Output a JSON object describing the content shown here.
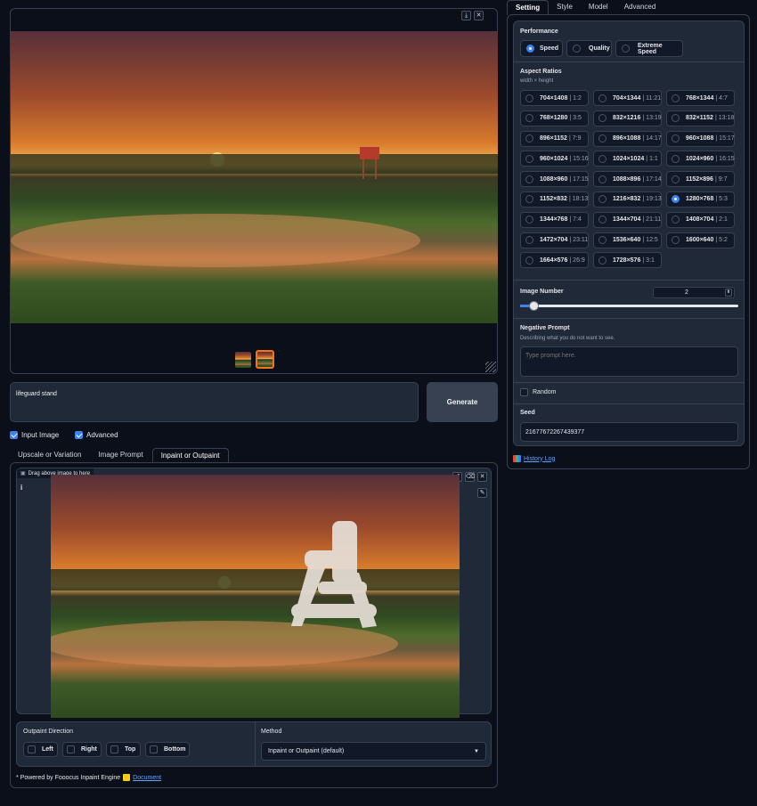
{
  "gallery": {
    "thumbnails": [
      "sunset-thumb-1",
      "sunset-thumb-2"
    ]
  },
  "prompt": {
    "value": "lifeguard stand"
  },
  "generate_label": "Generate",
  "checkboxes": {
    "input_image": {
      "label": "Input Image",
      "checked": true
    },
    "advanced": {
      "label": "Advanced",
      "checked": true
    }
  },
  "input_tabs": {
    "upscale": "Upscale or Variation",
    "image_prompt": "Image Prompt",
    "inpaint": "Inpaint or Outpaint"
  },
  "inpaint_canvas": {
    "drag_label": "Drag above image to here",
    "info_glyph": "i"
  },
  "outpaint": {
    "title": "Outpaint Direction",
    "options": [
      "Left",
      "Right",
      "Top",
      "Bottom"
    ]
  },
  "method": {
    "title": "Method",
    "value": "Inpaint or Outpaint (default)"
  },
  "footer": {
    "text": "* Powered by Fooocus Inpaint Engine",
    "link": "Document"
  },
  "settings_tabs": [
    "Setting",
    "Style",
    "Model",
    "Advanced"
  ],
  "performance": {
    "title": "Performance",
    "options": [
      "Speed",
      "Quality",
      "Extreme Speed"
    ],
    "selected": "Speed"
  },
  "aspect": {
    "title": "Aspect Ratios",
    "subtitle": "width × height",
    "options": [
      {
        "size": "704×1408",
        "ratio": "1:2"
      },
      {
        "size": "704×1344",
        "ratio": "11:21"
      },
      {
        "size": "768×1344",
        "ratio": "4:7"
      },
      {
        "size": "768×1280",
        "ratio": "3:5"
      },
      {
        "size": "832×1216",
        "ratio": "13:19"
      },
      {
        "size": "832×1152",
        "ratio": "13:18"
      },
      {
        "size": "896×1152",
        "ratio": "7:9"
      },
      {
        "size": "896×1088",
        "ratio": "14:17"
      },
      {
        "size": "960×1088",
        "ratio": "15:17"
      },
      {
        "size": "960×1024",
        "ratio": "15:16"
      },
      {
        "size": "1024×1024",
        "ratio": "1:1"
      },
      {
        "size": "1024×960",
        "ratio": "16:15"
      },
      {
        "size": "1088×960",
        "ratio": "17:15"
      },
      {
        "size": "1088×896",
        "ratio": "17:14"
      },
      {
        "size": "1152×896",
        "ratio": "9:7"
      },
      {
        "size": "1152×832",
        "ratio": "18:13"
      },
      {
        "size": "1216×832",
        "ratio": "19:13"
      },
      {
        "size": "1280×768",
        "ratio": "5:3"
      },
      {
        "size": "1344×768",
        "ratio": "7:4"
      },
      {
        "size": "1344×704",
        "ratio": "21:11"
      },
      {
        "size": "1408×704",
        "ratio": "2:1"
      },
      {
        "size": "1472×704",
        "ratio": "23:11"
      },
      {
        "size": "1536×640",
        "ratio": "12:5"
      },
      {
        "size": "1600×640",
        "ratio": "5:2"
      },
      {
        "size": "1664×576",
        "ratio": "26:9"
      },
      {
        "size": "1728×576",
        "ratio": "3:1"
      }
    ],
    "selected": "1280×768"
  },
  "image_number": {
    "title": "Image Number",
    "value": "2",
    "slider_fraction": 0.05
  },
  "negative_prompt": {
    "title": "Negative Prompt",
    "subtitle": "Describing what you do not want to see.",
    "placeholder": "Type prompt here."
  },
  "random": {
    "label": "Random",
    "checked": false
  },
  "seed": {
    "title": "Seed",
    "value": "216776722674393​77"
  },
  "history": {
    "label": "History Log"
  },
  "colors": {
    "accent": "#3b82f6",
    "bg": "#0b0f19",
    "panel": "#1f2937",
    "link": "#60a5fa"
  }
}
